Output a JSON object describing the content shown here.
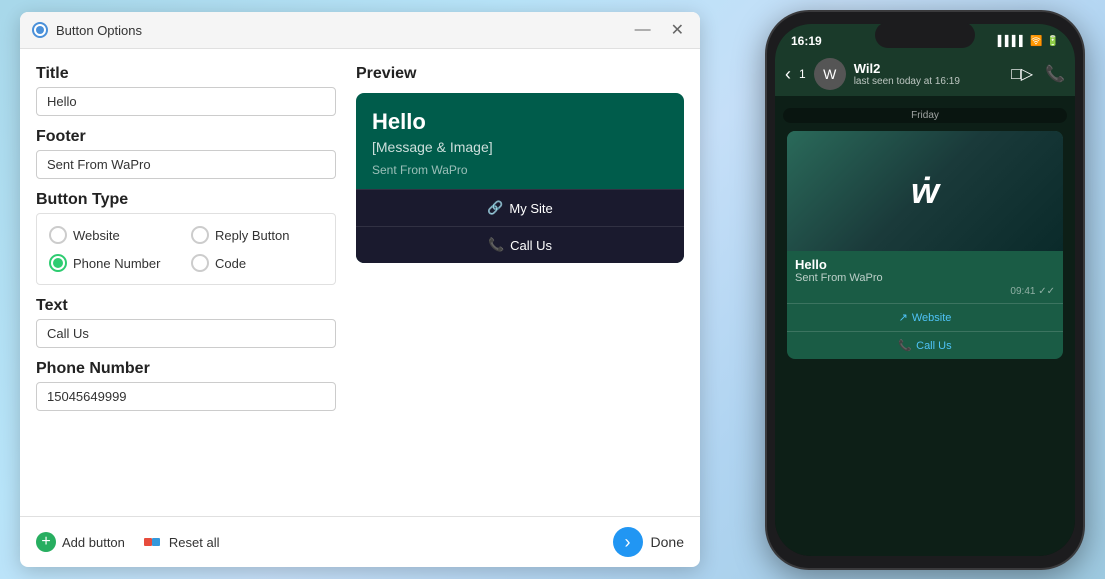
{
  "dialog": {
    "title": "Button Options",
    "minimize_label": "—",
    "close_label": "✕"
  },
  "left_panel": {
    "title_label": "Title",
    "title_value": "Hello",
    "title_placeholder": "Hello",
    "footer_label": "Footer",
    "footer_value": "Sent From WaPro",
    "footer_placeholder": "Sent From WaPro",
    "button_type_label": "Button Type",
    "radio_options": [
      {
        "label": "Website",
        "selected": false
      },
      {
        "label": "Reply Button",
        "selected": false
      },
      {
        "label": "Phone Number",
        "selected": true
      },
      {
        "label": "Code",
        "selected": false
      }
    ],
    "text_label": "Text",
    "text_value": "Call Us",
    "text_placeholder": "Call Us",
    "phone_label": "Phone Number",
    "phone_value": "15045649999",
    "phone_placeholder": "15045649999"
  },
  "footer_actions": {
    "add_button_label": "Add button",
    "reset_label": "Reset all",
    "done_label": "Done"
  },
  "preview": {
    "label": "Preview",
    "card_title": "Hello",
    "card_body": "[Message & Image]",
    "card_footer": "Sent From WaPro",
    "buttons": [
      {
        "icon": "🔗",
        "label": "My Site"
      },
      {
        "icon": "📞",
        "label": "Call Us"
      }
    ]
  },
  "phone": {
    "time": "16:19",
    "contact_name": "Wil2",
    "last_seen": "last seen today at 16:19",
    "day_label": "Friday",
    "message": {
      "title": "Hello",
      "footer": "Sent From WaPro",
      "time": "09:41",
      "buttons": [
        {
          "icon": "↗",
          "label": "Website"
        },
        {
          "icon": "📞",
          "label": "Call Us"
        }
      ]
    }
  }
}
